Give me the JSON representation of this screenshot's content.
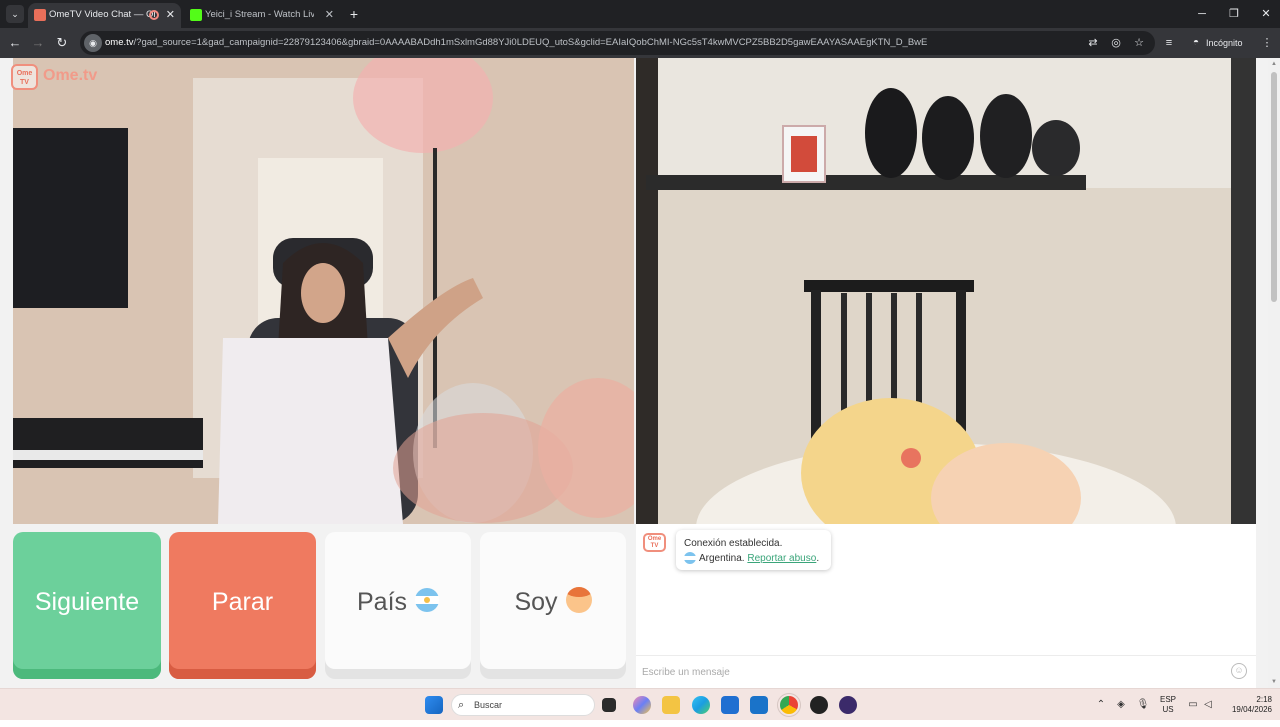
{
  "browser": {
    "tabs": [
      {
        "title": "OmeTV Video Chat — Ome",
        "active": true
      },
      {
        "title": "Yeici_i Stream - Watch Live on K",
        "active": false
      }
    ],
    "new_tab_label": "+",
    "url_host": "ome.tv",
    "url_rest": "/?gad_source=1&gad_campaignid=22879123406&gbraid=0AAAABADdh1mSxlmGd88YJi0LDEUQ_utoS&gclid=EAIaIQobChMI-NGc5sT4kwMVCPZ5BB2D5gawEAAYASAAEgKTN_D_BwE",
    "profile_label": "Incógnito"
  },
  "site": {
    "logo_badge": "Ome TV",
    "logo_text": "Ome.tv"
  },
  "controls": {
    "next_label": "Siguiente",
    "stop_label": "Parar",
    "country_label": "País",
    "gender_label": "Soy"
  },
  "chat": {
    "connection_text": "Conexión establecida.",
    "country_text": "Argentina.",
    "report_link": "Reportar abuso",
    "report_suffix": ".",
    "input_placeholder": "Escribe un mensaje"
  },
  "taskbar": {
    "search_placeholder": "Buscar",
    "lang_top": "ESP",
    "lang_bottom": "US",
    "time": "2:18",
    "date": "19/04/2026"
  },
  "colors": {
    "next_button": "#6cd09b",
    "stop_button": "#ef7a60",
    "link": "#3aa57a",
    "logo": "#f19b8a"
  }
}
